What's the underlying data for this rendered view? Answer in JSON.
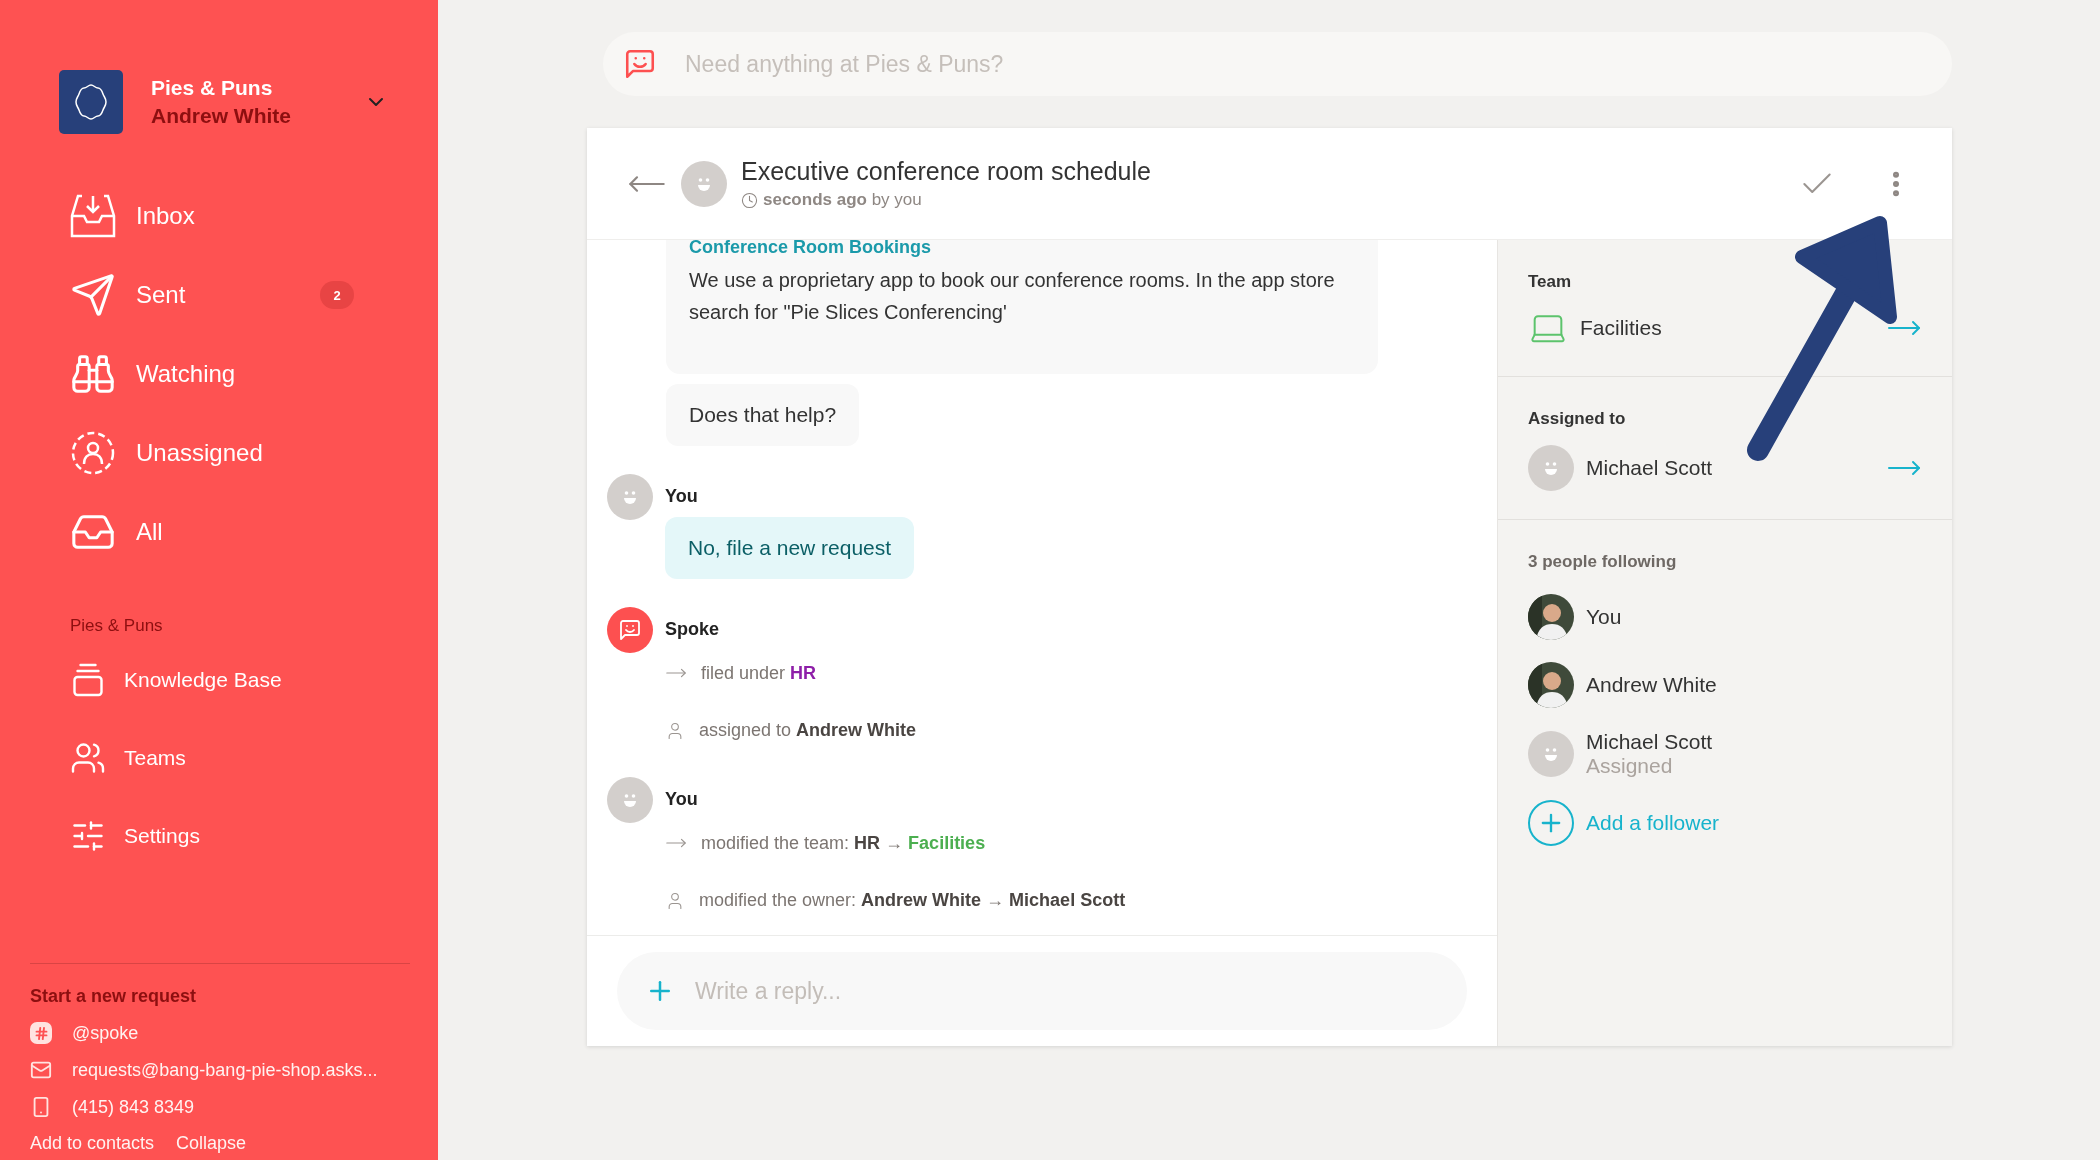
{
  "org": {
    "name": "Pies & Puns",
    "user": "Andrew White"
  },
  "nav": [
    {
      "kind": "inbox",
      "label": "Inbox"
    },
    {
      "kind": "sent",
      "label": "Sent",
      "badge": "2"
    },
    {
      "kind": "watching",
      "label": "Watching"
    },
    {
      "kind": "unassigned",
      "label": "Unassigned"
    },
    {
      "kind": "all",
      "label": "All"
    }
  ],
  "section": {
    "title": "Pies & Puns",
    "items": [
      {
        "kind": "knowledge",
        "label": "Knowledge Base"
      },
      {
        "kind": "teams",
        "label": "Teams"
      },
      {
        "kind": "settings",
        "label": "Settings"
      }
    ]
  },
  "new_request": {
    "title": "Start a new request",
    "channels": [
      {
        "kind": "slack",
        "text": "@spoke"
      },
      {
        "kind": "email",
        "text": "requests@bang-bang-pie-shop.asks..."
      },
      {
        "kind": "phone",
        "text": "(415) 843 8349"
      }
    ],
    "links": [
      "Add to contacts",
      "Collapse"
    ]
  },
  "search": {
    "placeholder": "Need anything at Pies & Puns?"
  },
  "request": {
    "title": "Executive conference room schedule",
    "time": "seconds ago",
    "by": "by you"
  },
  "messages": [
    {
      "kind": "article",
      "heading": "Conference Room Bookings",
      "text": "We use a proprietary app to book our conference rooms. In the app store search for \"Pie Slices Conferencing'"
    },
    {
      "kind": "bubble",
      "text": "Does that help?"
    },
    {
      "kind": "user_post",
      "author": "You",
      "reply": "No, file a new request"
    },
    {
      "kind": "bot_post",
      "author": "Spoke",
      "events": [
        {
          "kind": "arrow",
          "parts": [
            {
              "kind": "plain",
              "text": "filed under "
            },
            {
              "kind": "tag",
              "text": "HR",
              "color": "#8e1fa8"
            }
          ]
        },
        {
          "kind": "person",
          "parts": [
            {
              "kind": "plain",
              "text": "assigned to "
            },
            {
              "kind": "bold",
              "text": "Andrew White"
            }
          ]
        }
      ]
    },
    {
      "kind": "user_post",
      "author": "You",
      "events": [
        {
          "kind": "arrow",
          "parts": [
            {
              "kind": "plain",
              "text": "modified the team: "
            },
            {
              "kind": "bold",
              "text": "HR"
            },
            {
              "kind": "plain",
              "text": " → "
            },
            {
              "kind": "tag",
              "text": "Facilities",
              "color": "#4caf50"
            }
          ]
        },
        {
          "kind": "person",
          "parts": [
            {
              "kind": "plain",
              "text": "modified the owner: "
            },
            {
              "kind": "bold",
              "text": "Andrew White"
            },
            {
              "kind": "plain",
              "text": " → "
            },
            {
              "kind": "bold",
              "text": "Michael Scott"
            }
          ]
        }
      ]
    }
  ],
  "reply": {
    "placeholder": "Write a reply..."
  },
  "details": {
    "team": {
      "label": "Team",
      "name": "Facilities"
    },
    "assigned": {
      "label": "Assigned to",
      "name": "Michael Scott"
    },
    "followers": {
      "title": "3 people following",
      "people": [
        {
          "name": "You"
        },
        {
          "name": "Andrew White"
        },
        {
          "kind": "default",
          "name": "Michael Scott",
          "note": "Assigned"
        }
      ],
      "add": "Add a follower"
    }
  }
}
